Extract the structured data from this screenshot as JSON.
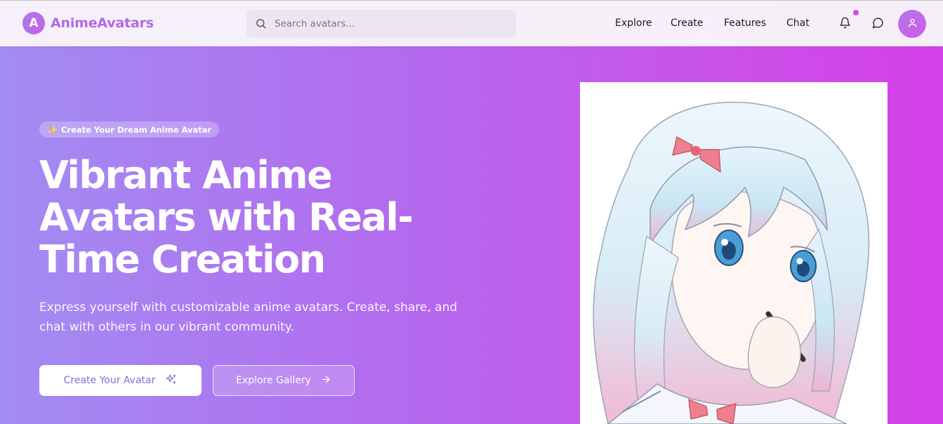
{
  "header": {
    "logo_letter": "A",
    "brand": "AnimeAvatars",
    "search_placeholder": "Search avatars...",
    "nav": [
      "Explore",
      "Create",
      "Features",
      "Chat"
    ],
    "icons": [
      "bell-icon",
      "chat-bubble-icon",
      "user-icon",
      "search-icon"
    ]
  },
  "hero": {
    "badge": "Create Your Dream Anime Avatar",
    "badge_icon": "sparkle-emoji",
    "headline_lines": [
      "Vibrant Anime",
      "Avatars with Real-",
      "Time Creation"
    ],
    "subtext": "Express yourself with customizable anime avatars. Create, share, and chat with others in our vibrant community.",
    "primary_button": "Create Your Avatar",
    "secondary_button": "Explore Gallery"
  },
  "colors": {
    "accent": "#b36ae6",
    "gradient_start": "#a28cf2",
    "gradient_end": "#d440e8",
    "notification_dot": "#d54ae2"
  }
}
